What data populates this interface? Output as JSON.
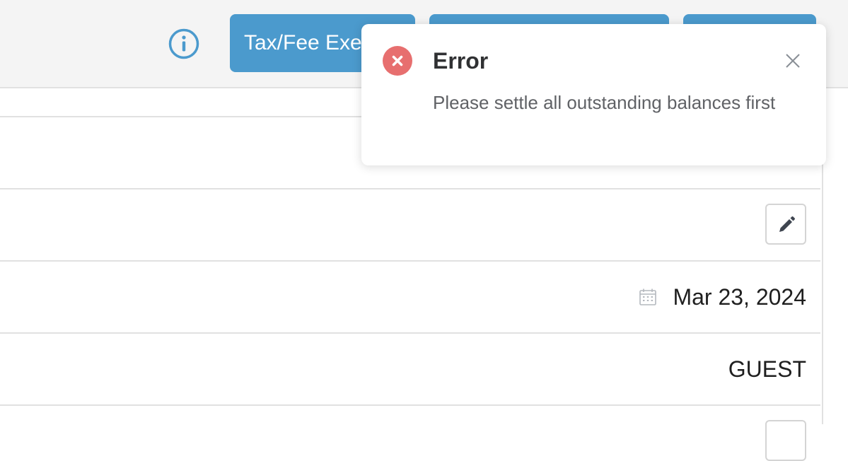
{
  "header": {
    "info_icon": "info-icon",
    "buttons": [
      {
        "label": "Tax/Fee Exe"
      },
      {
        "label": ""
      },
      {
        "label": ""
      }
    ]
  },
  "rows": {
    "date_value": "Mar 23, 2024",
    "guest_label": "GUEST"
  },
  "icons": {
    "edit": "pencil-icon",
    "calendar": "calendar-icon"
  },
  "notification": {
    "title": "Error",
    "message": "Please settle all outstanding balances first",
    "icon": "error-circle-icon",
    "close_icon": "close-icon"
  },
  "colors": {
    "primary_button": "#4b9acd",
    "error": "#e76f6f",
    "info_icon": "#4b9acd"
  }
}
